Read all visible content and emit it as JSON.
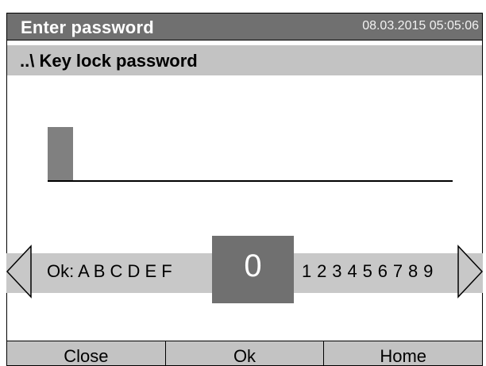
{
  "header": {
    "title": "Enter password",
    "datetime": "08.03.2015  05:05:06"
  },
  "subheader": {
    "path": "..\\ Key lock password"
  },
  "password_input": {
    "value": ""
  },
  "char_selector": {
    "left_chars": "Ok: A B C D E F",
    "selected_char": "0",
    "right_chars": "1 2 3 4 5 6 7 8 9"
  },
  "buttons": {
    "close_label": "Close",
    "ok_label": "Ok",
    "home_label": "Home"
  },
  "colors": {
    "title_bar": "#707070",
    "subtitle_bar": "#c3c3c3",
    "selector_band": "#c8c8c8",
    "selected_box": "#707070",
    "cursor": "#808080"
  },
  "icons": {
    "left_arrow": "arrow-left-icon",
    "right_arrow": "arrow-right-icon"
  }
}
